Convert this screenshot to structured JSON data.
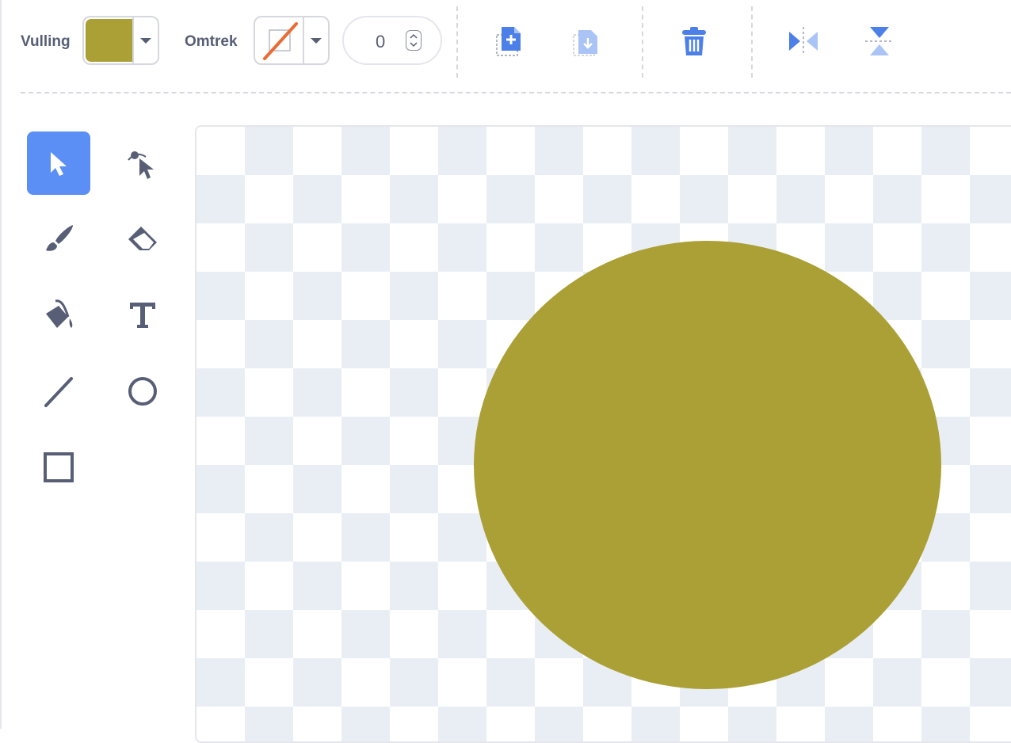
{
  "toolbar": {
    "fill_label": "Vulling",
    "fill_color": "#aba035",
    "outline_label": "Omtrek",
    "outline_color": "none",
    "outline_width": "0",
    "actions": [
      "copy-icon",
      "paste-icon",
      "delete-icon",
      "flip-horizontal-icon",
      "flip-vertical-icon"
    ]
  },
  "tools": [
    "select",
    "reshape",
    "brush",
    "eraser",
    "fill",
    "text",
    "line",
    "circle",
    "rectangle"
  ],
  "active_tool": "select",
  "canvas": {
    "shape": "ellipse",
    "shape_color": "#aba035",
    "background": "transparent-checkerboard"
  },
  "colors": {
    "accent": "#5c8ff5",
    "icon": "#575e75",
    "checker": "#e9eef5"
  }
}
